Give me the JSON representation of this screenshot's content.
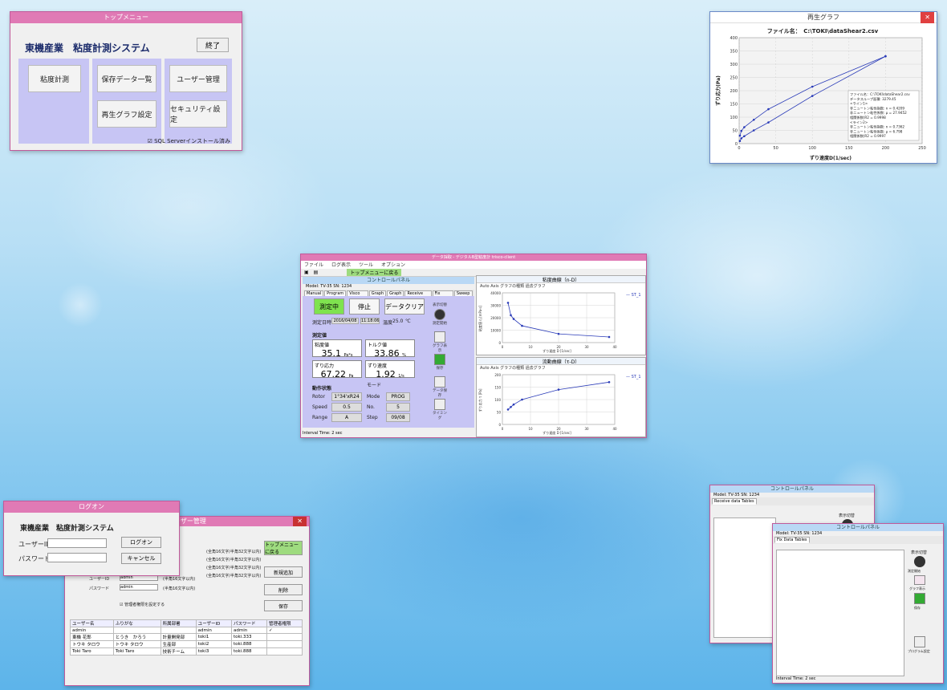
{
  "top_menu": {
    "title": "トップメニュー",
    "heading": "東機産業　粘度計測システム",
    "exit_label": "終了",
    "buttons": [
      "粘度計測",
      "保存データ一覧",
      "ユーザー管理",
      "再生グラフ設定",
      "セキュリティ設定"
    ],
    "check_label": "SQL Serverインストール済み"
  },
  "graph_window": {
    "title": "再生グラフ",
    "file_label": "ファイル名：　C:\\TOKI\\dataShear2.csv",
    "ylabel": "ずり応力(Pa)",
    "xlabel": "ずり速度D(1/sec)",
    "legend_lines": [
      "ファイル名：C:\\TOKI\\dataShear2.csv",
      "データスループ面積: 3279.45",
      "<ライン1>",
      "非ニュートン粘性指数: n = 0.4209",
      "非ニュートン粘性係数: μ = 27.9452",
      "相関係数(R2 = 0.9998",
      "<ライン2>",
      "非ニュートン粘性指数: n = 0.7362",
      "非ニュートン粘性係数: μ = 6.798",
      "相関係数(R2 = 0.9997"
    ]
  },
  "main_window": {
    "title": "データ採取 - デジタルB型粘度計 trisco-client",
    "menu": [
      "ファイル",
      "ログ表示",
      "ツール",
      "オプション"
    ],
    "toolbar_green": "トップメニューに戻る",
    "control_panel_title": "コントロールパネル",
    "model_line": "Model:  TV-35    SN:  1234",
    "tabs": [
      "Manual",
      "Program",
      "Visco Settings",
      "Graph Axis",
      "Graph Pen",
      "Receive Data Tables",
      "Fix Data Tables",
      "Sweep Mode"
    ],
    "btn_measure": "測定中",
    "btn_stop": "停止",
    "btn_clear": "データクリア",
    "date_label": "測定日時",
    "date_value": "2016/04/08",
    "time_value": "11:18:06",
    "temp_label": "温度",
    "temp_value": "25.0",
    "temp_unit": "℃",
    "section_measure": "測定値",
    "viscosity_label": "粘度値",
    "viscosity_value": "35.1",
    "viscosity_unit": "Pa*s",
    "torque_label": "トルク値",
    "torque_value": "33.86",
    "torque_unit": "%",
    "stress_label": "ずり応力",
    "stress_value": "67.22",
    "stress_unit": "Pa",
    "rate_label": "ずり速度",
    "rate_value": "1.92",
    "rate_unit": "1/s",
    "section_op": "動作状態",
    "mode_label": "モード",
    "rotor_label": "Rotor",
    "rotor_value": "1°34'xR24",
    "speed_label": "Speed",
    "speed_value": "0.5",
    "range_label": "Range",
    "range_value": "A",
    "mode2_label": "Mode",
    "mode2_value": "PROG",
    "no_label": "No.",
    "no_value": "5",
    "step_label": "Step",
    "step_value": "09/08",
    "icons": [
      "測定開始",
      "グラフ表示",
      "保存",
      "データ保存",
      "タイミング",
      "プログラム設定"
    ],
    "icon_header": "表示切替",
    "status": "Interval Time: 2 sec",
    "chart1_title": "粘度曲線（n-D）",
    "chart2_title": "流動曲線（τ-D）",
    "chart_sub": [
      "Auto Axis",
      "グラフの種類",
      "過去グラフ"
    ],
    "legend": "ST_1",
    "chart1_xlabel": "ずり速度 D [1/sec]",
    "chart1_ylabel": "粘度値 η [mPa·s]",
    "chart2_ylabel": "ずり応力 τ [Pa]"
  },
  "login": {
    "title": "ログオン",
    "heading": "東機産業　粘度計測システム",
    "user_label": "ユーザーID",
    "password_label": "パスワード",
    "login_btn": "ログオン",
    "cancel_btn": "キャンセル"
  },
  "user_mgmt": {
    "title": "ユーザー管理",
    "top_btn": "トップメニューに戻る",
    "btns": [
      "新規追加",
      "削除",
      "保存"
    ],
    "hints": [
      "(全角16文字/半角32文字以内)",
      "(全角16文字/半角32文字以内)",
      "(全角16文字/半角32文字以内)",
      "(全角16文字/半角32文字以内)",
      "(半角16文字以内)",
      "(半角16文字以内)"
    ],
    "user_id_label": "ユーザーID",
    "password_label": "パスワード",
    "field_value": "admin",
    "admin_check": "管理者権限を設定する",
    "columns": [
      "ユーザー名",
      "ふりがな",
      "所属部署",
      "ユーザーID",
      "パスワード",
      "管理者権限"
    ],
    "rows": [
      [
        "admin",
        "",
        "",
        "admin",
        "admin",
        "✓"
      ],
      [
        "東機 花郎",
        "とうき　かろう",
        "計量開発部",
        "toki1",
        "toki.333",
        ""
      ],
      [
        "トウキ タロウ",
        "トウキ タロウ",
        "生産部",
        "toki2",
        "toki.888",
        ""
      ],
      [
        "Toki Taro",
        "Toki Taro",
        "技術チーム",
        "toki3",
        "toki.888",
        ""
      ]
    ]
  },
  "ctl_back": {
    "title": "コントロールパネル",
    "model_line": "Model:  TV-35    SN:  1234",
    "tab_active": "Receive data Tables",
    "header": "表示切替"
  },
  "ctl_front": {
    "title": "コントロールパネル",
    "model_line": "Model:  TV-35    SN:  1234",
    "tab_active": "Fix Data Tables",
    "header": "表示切替",
    "status": "Interval Time: 2 sec",
    "icons": [
      "測定開始",
      "グラフ表示",
      "保存",
      "プログラム設定"
    ]
  },
  "chart_data": [
    {
      "type": "line",
      "title": "",
      "xlabel": "ずり速度D(1/sec)",
      "ylabel": "ずり応力(Pa)",
      "xlim": [
        0,
        250
      ],
      "ylim": [
        0,
        400
      ],
      "series": [
        {
          "x": [
            1,
            3,
            7,
            20,
            40,
            100,
            200
          ],
          "values": [
            10,
            20,
            28,
            50,
            80,
            180,
            330
          ]
        },
        {
          "x": [
            1,
            3,
            7,
            20,
            40,
            100,
            200
          ],
          "values": [
            30,
            48,
            62,
            90,
            130,
            215,
            330
          ]
        }
      ]
    },
    {
      "type": "line",
      "title": "粘度曲線（n-D）",
      "xlabel": "ずり速度 D [1/sec]",
      "xlim": [
        0,
        40
      ],
      "ylim": [
        0,
        40000
      ],
      "series": [
        {
          "name": "ST_1",
          "x": [
            2,
            3,
            4,
            7,
            20,
            38
          ],
          "values": [
            32000,
            22000,
            19000,
            13500,
            7000,
            4500
          ]
        }
      ]
    },
    {
      "type": "line",
      "title": "流動曲線（τ-D）",
      "xlabel": "ずり速度 D [1/sec]",
      "xlim": [
        0,
        40
      ],
      "ylim": [
        0,
        200
      ],
      "series": [
        {
          "name": "ST_1",
          "x": [
            2,
            3,
            4,
            7,
            20,
            38
          ],
          "values": [
            60,
            70,
            80,
            100,
            140,
            170
          ]
        }
      ]
    }
  ]
}
